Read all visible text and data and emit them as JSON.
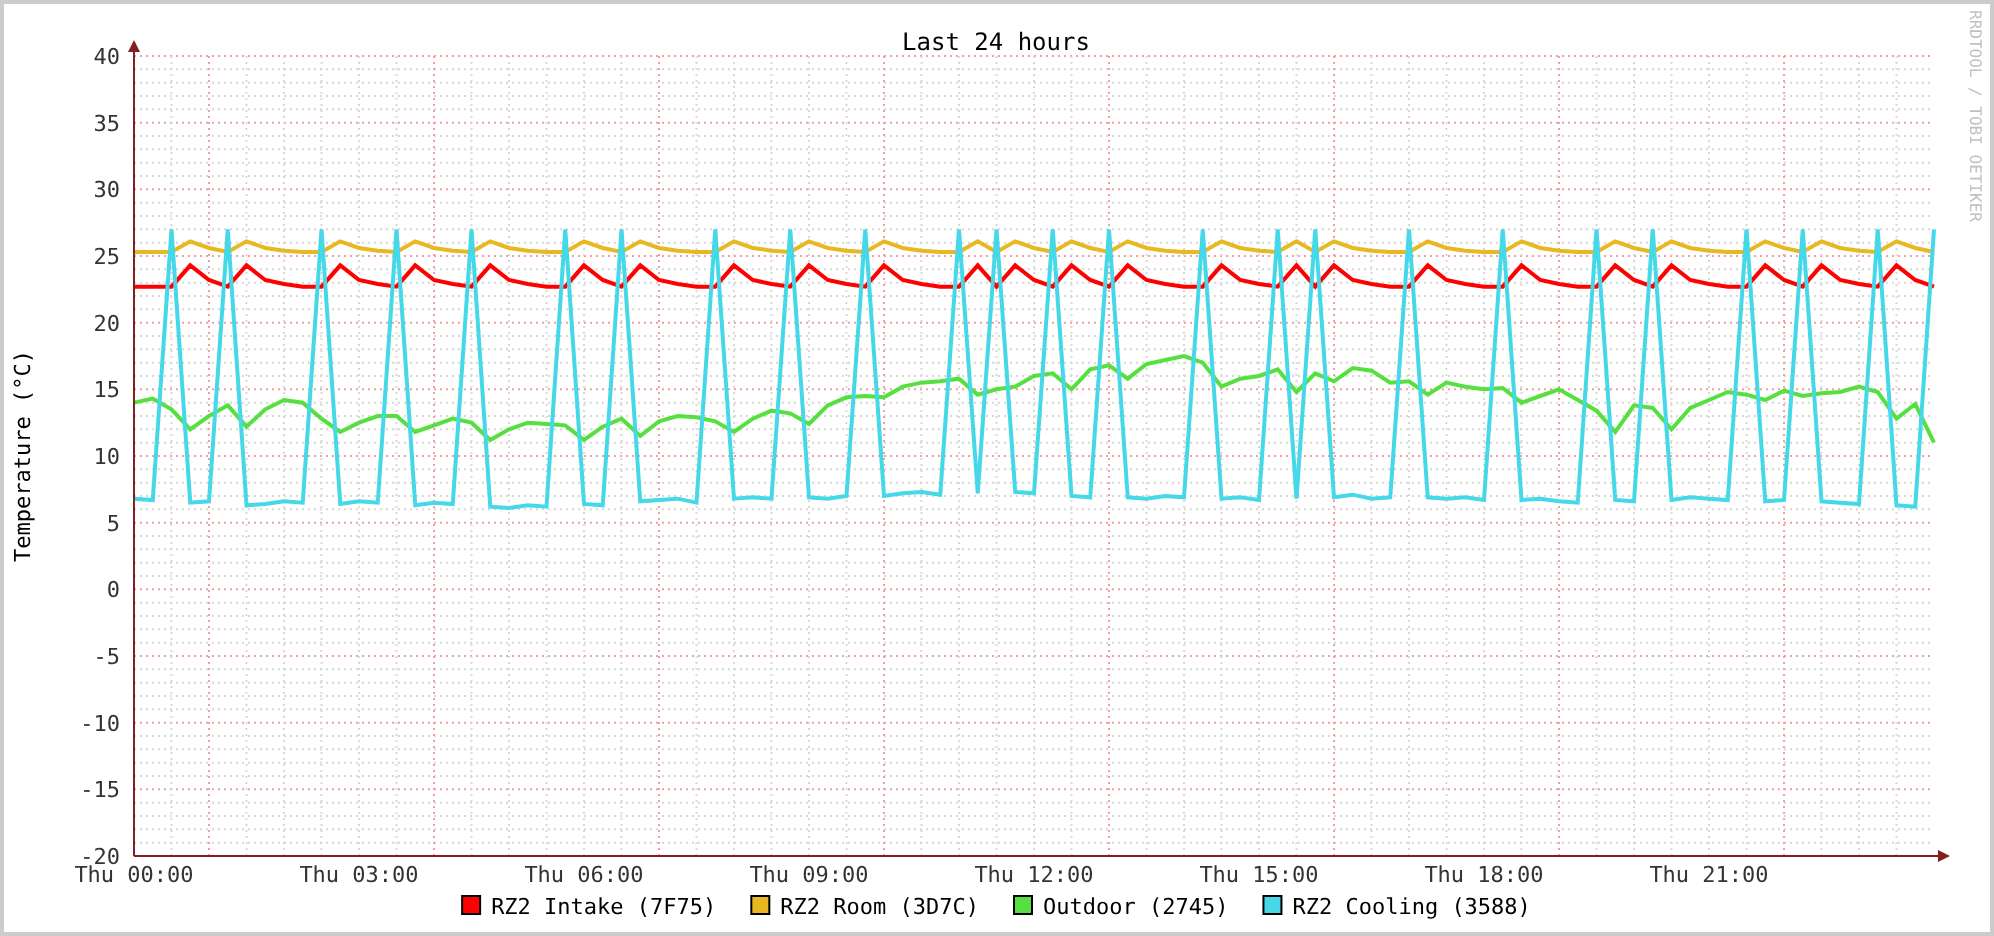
{
  "chart": {
    "chart_data": {
      "type": "line",
      "title": "Last 24 hours",
      "ylabel": "Temperature (°C)",
      "ylim": [
        -20,
        40
      ],
      "grid": true,
      "legend": true,
      "yticks": [
        40,
        35,
        30,
        25,
        20,
        15,
        10,
        5,
        0,
        -5,
        -10,
        -15,
        -20
      ],
      "categories": [
        "Thu 00:00",
        null,
        null,
        null,
        null,
        null,
        null,
        null,
        null,
        null,
        null,
        null,
        "Thu 03:00",
        null,
        null,
        null,
        null,
        null,
        null,
        null,
        null,
        null,
        null,
        null,
        "Thu 06:00",
        null,
        null,
        null,
        null,
        null,
        null,
        null,
        null,
        null,
        null,
        null,
        "Thu 09:00",
        null,
        null,
        null,
        null,
        null,
        null,
        null,
        null,
        null,
        null,
        null,
        "Thu 12:00",
        null,
        null,
        null,
        null,
        null,
        null,
        null,
        null,
        null,
        null,
        null,
        "Thu 15:00",
        null,
        null,
        null,
        null,
        null,
        null,
        null,
        null,
        null,
        null,
        null,
        "Thu 18:00",
        null,
        null,
        null,
        null,
        null,
        null,
        null,
        null,
        null,
        null,
        null,
        "Thu 21:00",
        null,
        null,
        null,
        null,
        null,
        null,
        null,
        null,
        null,
        null,
        null,
        null
      ],
      "series": [
        {
          "name": "RZ2 Intake (7F75)",
          "color": "#ff0000",
          "values": [
            22.7,
            22.7,
            22.7,
            24.3,
            23.2,
            22.7,
            24.3,
            23.2,
            22.9,
            22.7,
            22.7,
            24.3,
            23.2,
            22.9,
            22.7,
            24.3,
            23.2,
            22.9,
            22.7,
            24.3,
            23.2,
            22.9,
            22.7,
            22.7,
            24.3,
            23.2,
            22.7,
            24.3,
            23.2,
            22.9,
            22.7,
            22.7,
            24.3,
            23.2,
            22.9,
            22.7,
            24.3,
            23.2,
            22.9,
            22.7,
            24.3,
            23.2,
            22.9,
            22.7,
            22.7,
            24.3,
            22.7,
            24.3,
            23.2,
            22.7,
            24.3,
            23.2,
            22.7,
            24.3,
            23.2,
            22.9,
            22.7,
            22.7,
            24.3,
            23.2,
            22.9,
            22.7,
            24.3,
            22.7,
            24.3,
            23.2,
            22.9,
            22.7,
            22.7,
            24.3,
            23.2,
            22.9,
            22.7,
            22.7,
            24.3,
            23.2,
            22.9,
            22.7,
            22.7,
            24.3,
            23.2,
            22.7,
            24.3,
            23.2,
            22.9,
            22.7,
            22.7,
            24.3,
            23.2,
            22.7,
            24.3,
            23.2,
            22.9,
            22.7,
            24.3,
            23.2,
            22.7
          ]
        },
        {
          "name": "RZ2 Room (3D7C)",
          "color": "#e8b820",
          "values": [
            25.3,
            25.3,
            25.3,
            26.1,
            25.6,
            25.3,
            26.1,
            25.6,
            25.4,
            25.3,
            25.3,
            26.1,
            25.6,
            25.4,
            25.3,
            26.1,
            25.6,
            25.4,
            25.3,
            26.1,
            25.6,
            25.4,
            25.3,
            25.3,
            26.1,
            25.6,
            25.3,
            26.1,
            25.6,
            25.4,
            25.3,
            25.3,
            26.1,
            25.6,
            25.4,
            25.3,
            26.1,
            25.6,
            25.4,
            25.3,
            26.1,
            25.6,
            25.4,
            25.3,
            25.3,
            26.1,
            25.3,
            26.1,
            25.6,
            25.3,
            26.1,
            25.6,
            25.3,
            26.1,
            25.6,
            25.4,
            25.3,
            25.3,
            26.1,
            25.6,
            25.4,
            25.3,
            26.1,
            25.3,
            26.1,
            25.6,
            25.4,
            25.3,
            25.3,
            26.1,
            25.6,
            25.4,
            25.3,
            25.3,
            26.1,
            25.6,
            25.4,
            25.3,
            25.3,
            26.1,
            25.6,
            25.3,
            26.1,
            25.6,
            25.4,
            25.3,
            25.3,
            26.1,
            25.6,
            25.3,
            26.1,
            25.6,
            25.4,
            25.3,
            26.1,
            25.6,
            25.3
          ]
        },
        {
          "name": "Outdoor (2745)",
          "color": "#55e040",
          "values": [
            14.0,
            14.3,
            13.5,
            12.0,
            13.0,
            13.8,
            12.2,
            13.5,
            14.2,
            14.0,
            12.8,
            11.8,
            12.5,
            13.0,
            13.0,
            11.8,
            12.3,
            12.8,
            12.5,
            11.2,
            12.0,
            12.5,
            12.4,
            12.3,
            11.2,
            12.2,
            12.8,
            11.5,
            12.6,
            13.0,
            12.9,
            12.6,
            11.8,
            12.8,
            13.4,
            13.2,
            12.4,
            13.8,
            14.4,
            14.5,
            14.4,
            15.2,
            15.5,
            15.6,
            15.8,
            14.6,
            15.0,
            15.2,
            16.0,
            16.2,
            15.0,
            16.5,
            16.8,
            15.8,
            16.9,
            17.2,
            17.5,
            17.0,
            15.2,
            15.8,
            16.0,
            16.5,
            14.8,
            16.2,
            15.6,
            16.6,
            16.4,
            15.5,
            15.6,
            14.6,
            15.5,
            15.2,
            15.0,
            15.1,
            14.0,
            14.5,
            15.0,
            14.2,
            13.4,
            11.8,
            13.8,
            13.6,
            12.0,
            13.6,
            14.2,
            14.8,
            14.6,
            14.2,
            14.9,
            14.5,
            14.7,
            14.8,
            15.2,
            14.8,
            12.8,
            13.9,
            11.0
          ]
        },
        {
          "name": "RZ2 Cooling (3588)",
          "color": "#44d8e8",
          "values": [
            6.8,
            6.7,
            27,
            6.5,
            6.6,
            27,
            6.3,
            6.4,
            6.6,
            6.5,
            27,
            6.4,
            6.6,
            6.5,
            27,
            6.3,
            6.5,
            6.4,
            27,
            6.2,
            6.1,
            6.3,
            6.2,
            27,
            6.4,
            6.3,
            27,
            6.6,
            6.7,
            6.8,
            6.5,
            27,
            6.8,
            6.9,
            6.8,
            27,
            6.9,
            6.8,
            7.0,
            27,
            7.0,
            7.2,
            7.3,
            7.1,
            27,
            7.2,
            27,
            7.3,
            7.2,
            27,
            7.0,
            6.9,
            27,
            6.9,
            6.8,
            7.0,
            6.9,
            27,
            6.8,
            6.9,
            6.7,
            27,
            6.8,
            27,
            6.9,
            7.1,
            6.8,
            6.9,
            27,
            6.9,
            6.8,
            6.9,
            6.7,
            27,
            6.7,
            6.8,
            6.6,
            6.5,
            27,
            6.7,
            6.6,
            27,
            6.7,
            6.9,
            6.8,
            6.7,
            27,
            6.6,
            6.7,
            27,
            6.6,
            6.5,
            6.4,
            27,
            6.3,
            6.2,
            27
          ]
        }
      ]
    }
  },
  "credit": "RRDTOOL / TOBI OETIKER"
}
